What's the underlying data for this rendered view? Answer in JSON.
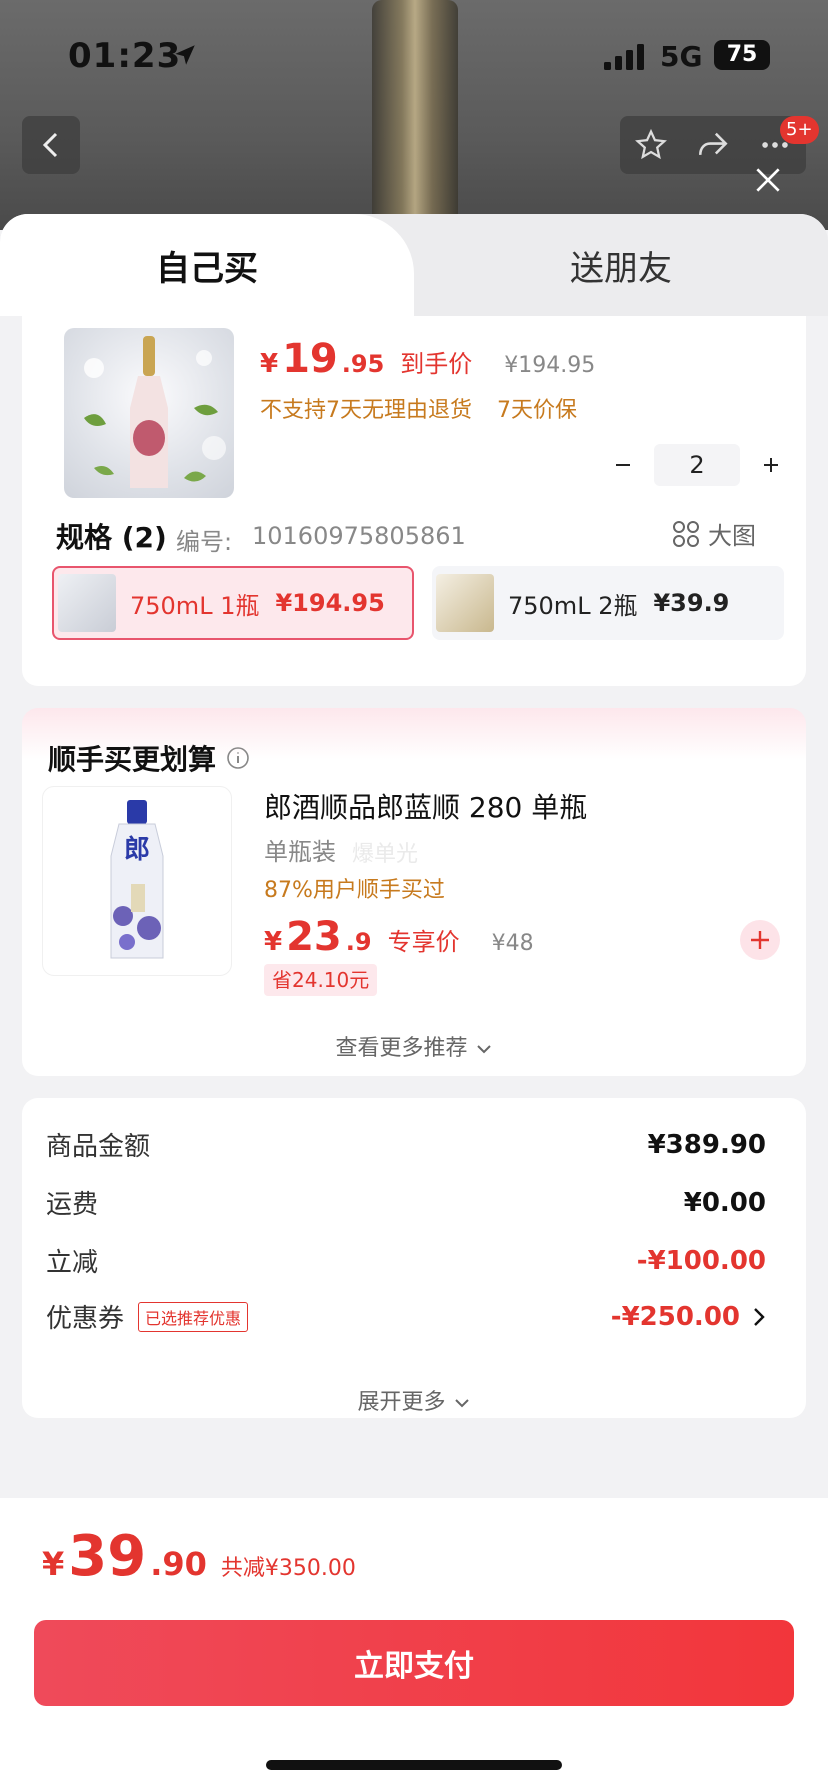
{
  "status": {
    "time": "01:23",
    "network": "5G",
    "battery": "75"
  },
  "nav": {
    "badge": "5+"
  },
  "tabs": [
    {
      "label": "自己买"
    },
    {
      "label": "送朋友"
    }
  ],
  "product": {
    "price_yen": "¥",
    "price_int": "19",
    "price_dec": ".95",
    "price_tag": "到手价",
    "original_price": "¥194.95",
    "notes": [
      "不支持7天无理由退货",
      "7天价保"
    ],
    "quantity": "2"
  },
  "spec": {
    "title": "规格 (2)",
    "code_label": "编号:",
    "code": "10160975805861",
    "big_image_label": "大图",
    "options": [
      {
        "label": "750mL 1瓶",
        "price": "¥194.95",
        "selected": true
      },
      {
        "label": "750mL 2瓶",
        "price": "¥39.9",
        "selected": false
      }
    ]
  },
  "addon": {
    "title": "顺手买更划算",
    "name": "郎酒顺品郎蓝顺 280 单瓶",
    "pack": "单瓶装",
    "ghost": "爆单光",
    "buy_rate": "87%用户顺手买过",
    "price_yen": "¥",
    "price_int": "23",
    "price_dec": ".9",
    "price_tag": "专享价",
    "original_price": "¥48",
    "save": "省24.10元",
    "more": "查看更多推荐"
  },
  "summary": {
    "rows": [
      {
        "label": "商品金额",
        "value": "¥389.90"
      },
      {
        "label": "运费",
        "value": "¥0.00"
      },
      {
        "label": "立减",
        "value": "-¥100.00"
      },
      {
        "label": "优惠券",
        "tag": "已选推荐优惠",
        "value": "-¥250.00"
      }
    ],
    "expand": "展开更多"
  },
  "footer": {
    "yen": "¥",
    "total_int": "39",
    "total_dec": ".90",
    "saved": "共减¥350.00",
    "pay_label": "立即支付"
  },
  "colors": {
    "accent": "#e3352f",
    "warning": "#c77a1e"
  }
}
